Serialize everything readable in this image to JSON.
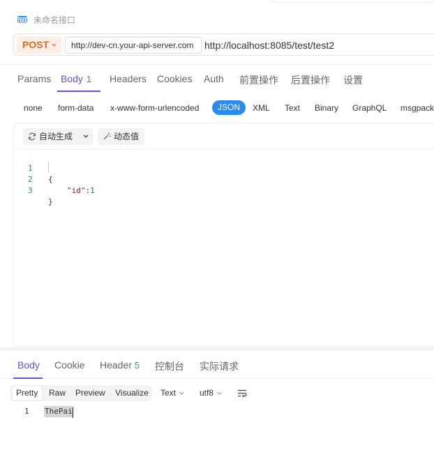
{
  "title": {
    "text": "未命名接口"
  },
  "request": {
    "method": "POST",
    "environment": "http://dev-cn.your-api-server.com",
    "url": "http://localhost:8085/test/test2"
  },
  "request_tabs": [
    {
      "label": "Params"
    },
    {
      "label": "Body",
      "count": "1",
      "active": true
    },
    {
      "label": "Headers"
    },
    {
      "label": "Cookies"
    },
    {
      "label": "Auth"
    },
    {
      "label": "前置操作"
    },
    {
      "label": "后置操作"
    },
    {
      "label": "设置"
    }
  ],
  "body_types": [
    {
      "label": "none"
    },
    {
      "label": "form-data"
    },
    {
      "label": "x-www-form-urlencoded"
    },
    {
      "label": "JSON",
      "active": true
    },
    {
      "label": "XML"
    },
    {
      "label": "Text"
    },
    {
      "label": "Binary"
    },
    {
      "label": "GraphQL"
    },
    {
      "label": "msgpack"
    }
  ],
  "editor": {
    "auto_generate_label": "自动生成",
    "dynamic_value_label": "动态值",
    "lines": [
      {
        "number": "1",
        "open": "{"
      },
      {
        "number": "2",
        "key": "\"id\"",
        "colon": ":",
        "value": "1"
      },
      {
        "number": "3",
        "close": "}"
      }
    ]
  },
  "response_tabs": [
    {
      "label": "Body",
      "active": true
    },
    {
      "label": "Cookie"
    },
    {
      "label": "Header",
      "count": "5"
    },
    {
      "label": "控制台"
    },
    {
      "label": "实际请求"
    }
  ],
  "response_toolbar": {
    "views": [
      {
        "label": "Pretty",
        "active": true
      },
      {
        "label": "Raw"
      },
      {
        "label": "Preview"
      },
      {
        "label": "Visualize"
      }
    ],
    "format": "Text",
    "encoding": "utf8"
  },
  "response_body": {
    "lines": [
      {
        "number": "1",
        "text": "ThePai"
      }
    ]
  },
  "colors": {
    "accent": "#6b4ed8",
    "method": "#e8692b",
    "json_active": "#2b8cf0",
    "count": "#2e9c5a"
  }
}
